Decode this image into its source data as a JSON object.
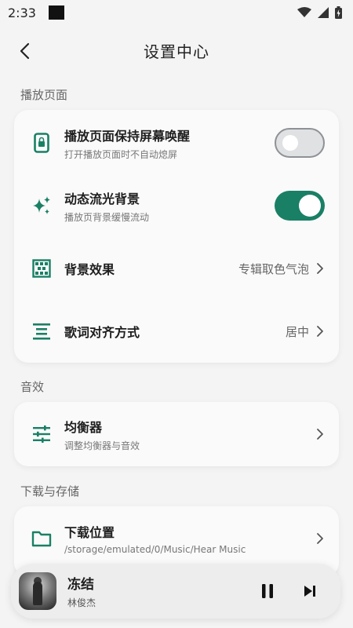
{
  "status_bar": {
    "time": "2:33"
  },
  "header": {
    "title": "设置中心"
  },
  "sections": {
    "playback": {
      "label": "播放页面",
      "keep_awake": {
        "title": "播放页面保持屏幕唤醒",
        "subtitle": "打开播放页面时不自动熄屏",
        "enabled": false
      },
      "dynamic_bg": {
        "title": "动态流光背景",
        "subtitle": "播放页背景缓慢流动",
        "enabled": true
      },
      "bg_effect": {
        "title": "背景效果",
        "value": "专辑取色气泡"
      },
      "lyrics_align": {
        "title": "歌词对齐方式",
        "value": "居中"
      }
    },
    "sound": {
      "label": "音效",
      "equalizer": {
        "title": "均衡器",
        "subtitle": "调整均衡器与音效"
      }
    },
    "storage": {
      "label": "下载与存储",
      "download_location": {
        "title": "下载位置",
        "subtitle": "/storage/emulated/0/Music/Hear Music"
      }
    }
  },
  "player": {
    "title": "冻结",
    "artist": "林俊杰"
  },
  "colors": {
    "accent": "#1a8065",
    "background": "#f4f4f4",
    "card": "#fafafa"
  }
}
